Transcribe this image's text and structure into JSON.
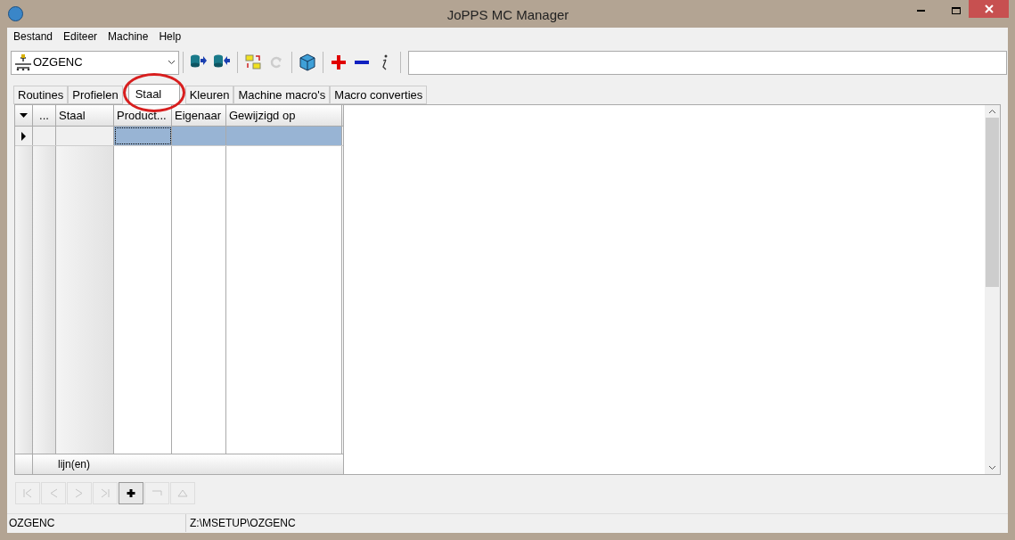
{
  "window": {
    "title": "JoPPS MC Manager"
  },
  "menu": [
    "Bestand",
    "Editeer",
    "Machine",
    "Help"
  ],
  "toolbar": {
    "machine": "OZGENC",
    "buttons": [
      {
        "kind": "db-out",
        "disabled": false
      },
      {
        "kind": "db-in",
        "disabled": false
      },
      {
        "kind": "swap",
        "disabled": false
      },
      {
        "kind": "redo",
        "disabled": true
      },
      {
        "kind": "cube",
        "disabled": false
      },
      {
        "kind": "plus",
        "disabled": false
      },
      {
        "kind": "minus",
        "disabled": false
      },
      {
        "kind": "info",
        "disabled": false
      }
    ]
  },
  "tabs": [
    {
      "label": "Routines",
      "selected": false
    },
    {
      "label": "Profielen",
      "selected": false
    },
    {
      "label": "Staal",
      "selected": true,
      "circled": true
    },
    {
      "label": "Kleuren",
      "selected": false
    },
    {
      "label": "Machine macro's",
      "selected": false
    },
    {
      "label": "Macro converties",
      "selected": false
    }
  ],
  "grid": {
    "columns": [
      "...",
      "Staal",
      "Product...",
      "Eigenaar",
      "Gewijzigd op"
    ],
    "rows": [
      {
        "selected": true
      }
    ],
    "footer": "lijn(en)"
  },
  "navigator": [
    {
      "kind": "first",
      "disabled": true
    },
    {
      "kind": "prior",
      "disabled": true
    },
    {
      "kind": "next",
      "disabled": true
    },
    {
      "kind": "last",
      "disabled": true
    },
    {
      "kind": "insert",
      "disabled": false
    },
    {
      "kind": "cancel",
      "disabled": true
    },
    {
      "kind": "post",
      "disabled": true
    }
  ],
  "status_bar": [
    "OZGENC",
    "Z:\\MSETUP\\OZGENC"
  ]
}
